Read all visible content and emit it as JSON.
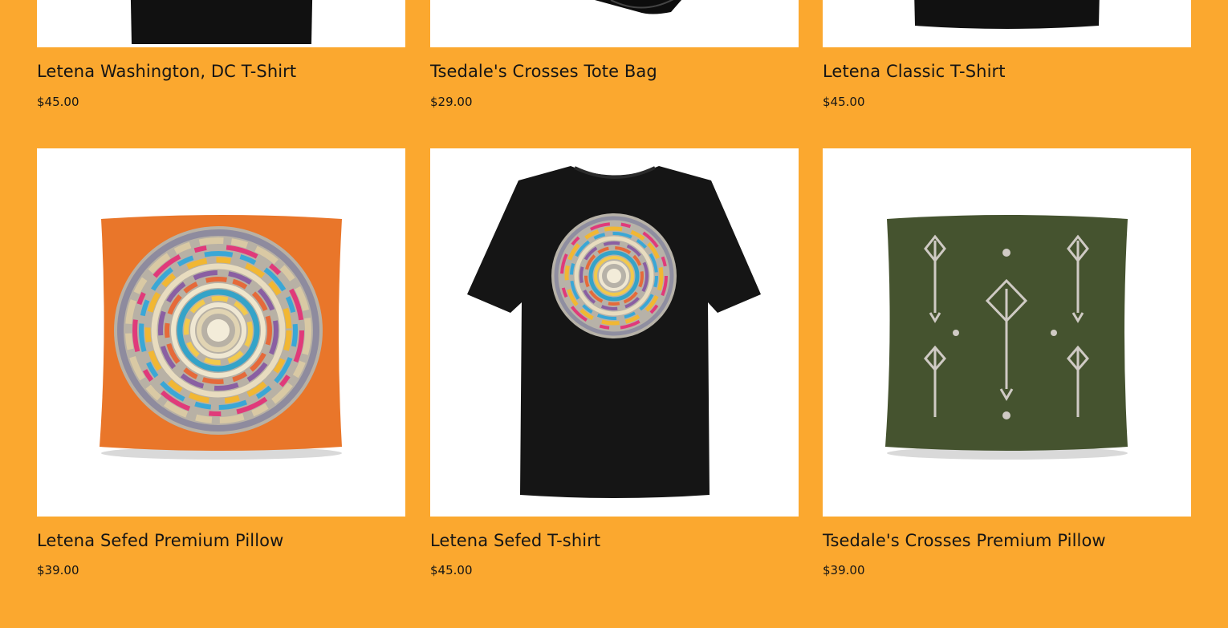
{
  "theme": {
    "background": "#FBA82F",
    "card_bg": "#FFFFFF",
    "text": "#151515"
  },
  "products": [
    {
      "title": "Letena Washington, DC T-Shirt",
      "price": "$45.00",
      "image": "black-tshirt-image"
    },
    {
      "title": "Tsedale's Crosses Tote Bag",
      "price": "$29.00",
      "image": "black-tote-bag-image"
    },
    {
      "title": "Letena Classic T-Shirt",
      "price": "$45.00",
      "image": "black-tshirt-image"
    },
    {
      "title": "Letena Sefed Premium Pillow",
      "price": "$39.00",
      "image": "orange-pillow-basket-image"
    },
    {
      "title": "Letena Sefed T-shirt",
      "price": "$45.00",
      "image": "black-tshirt-basket-image"
    },
    {
      "title": "Tsedale's Crosses Premium Pillow",
      "price": "$39.00",
      "image": "green-pillow-crosses-image"
    }
  ]
}
